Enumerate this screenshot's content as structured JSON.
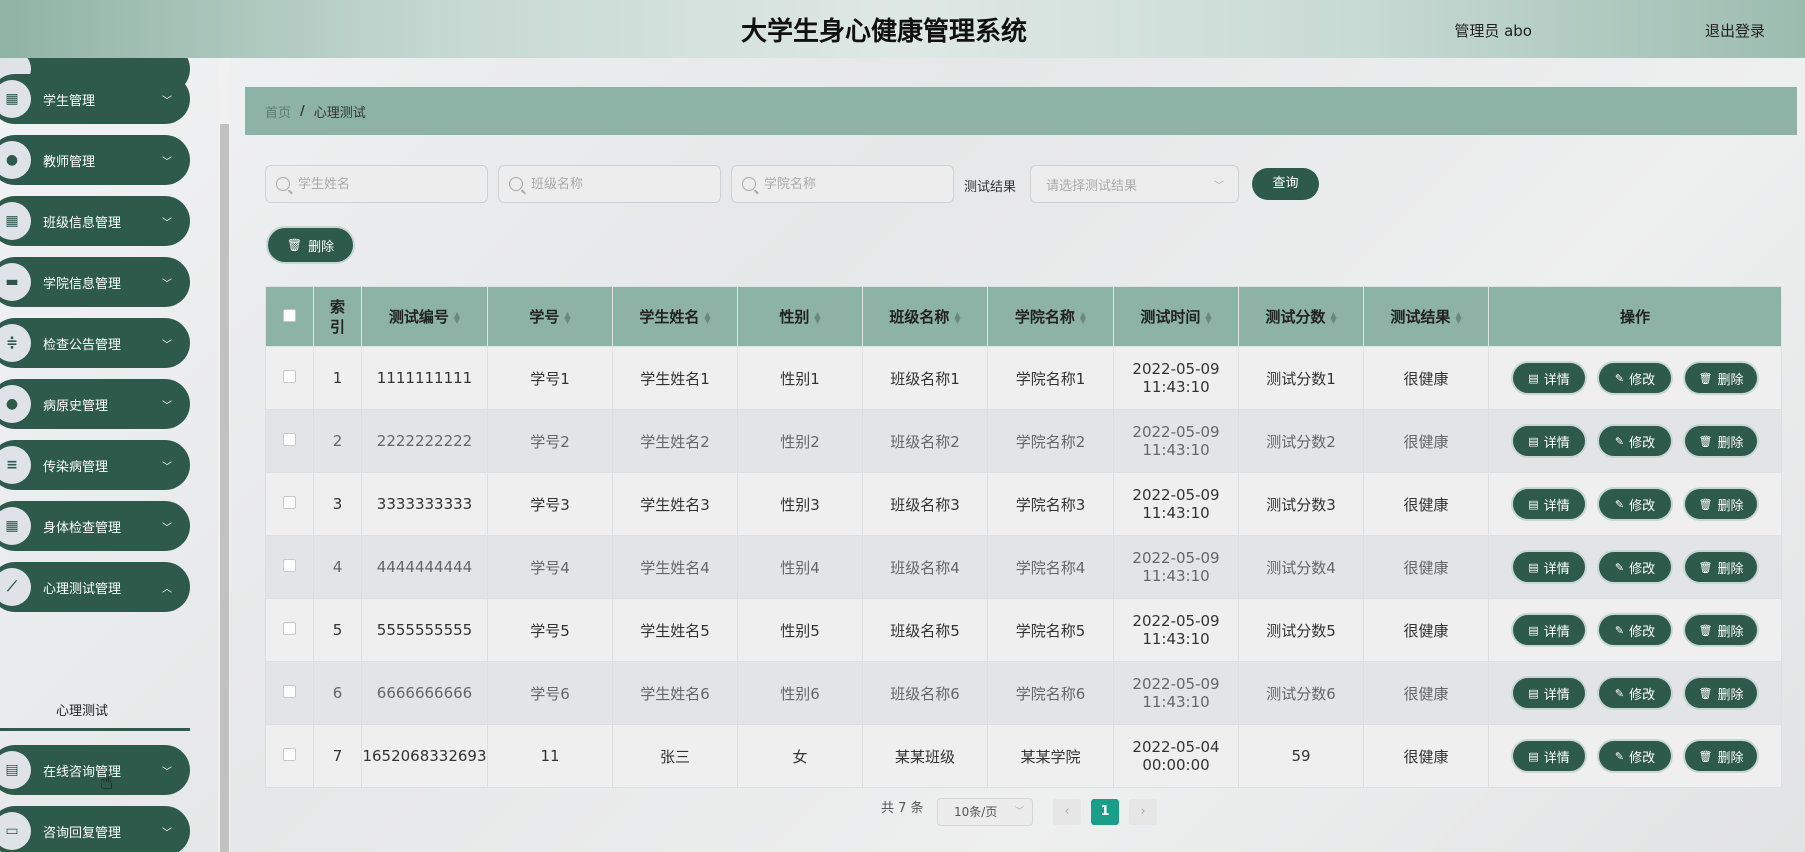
{
  "header": {
    "title": "大学生身心健康管理系统",
    "admin": "管理员 abo",
    "logout": "退出登录"
  },
  "sidebar": {
    "items": [
      {
        "label": "学生管理",
        "icon": "grid-icon"
      },
      {
        "label": "教师管理",
        "icon": "lightbulb-icon"
      },
      {
        "label": "班级信息管理",
        "icon": "grid-icon"
      },
      {
        "label": "学院信息管理",
        "icon": "briefcase-icon"
      },
      {
        "label": "检查公告管理",
        "icon": "sliders-icon"
      },
      {
        "label": "病原史管理",
        "icon": "user-icon"
      },
      {
        "label": "传染病管理",
        "icon": "list-icon"
      },
      {
        "label": "身体检查管理",
        "icon": "grid-icon"
      },
      {
        "label": "心理测试管理",
        "icon": "chart-icon"
      },
      {
        "label": "在线咨询管理",
        "icon": "clipboard-icon"
      },
      {
        "label": "咨询回复管理",
        "icon": "message-icon"
      }
    ],
    "submenu_active": "心理测试"
  },
  "breadcrumb": {
    "home": "首页",
    "separator": "/",
    "current": "心理测试"
  },
  "filters": {
    "student_name_placeholder": "学生姓名",
    "class_name_placeholder": "班级名称",
    "college_name_placeholder": "学院名称",
    "result_label": "测试结果",
    "result_placeholder": "请选择测试结果",
    "query_button": "查询"
  },
  "toolbar": {
    "delete_button": "删除"
  },
  "table": {
    "columns": [
      "索引",
      "测试编号",
      "学号",
      "学生姓名",
      "性别",
      "班级名称",
      "学院名称",
      "测试时间",
      "测试分数",
      "测试结果",
      "操作"
    ],
    "rows": [
      {
        "index": "1",
        "code": "1111111111",
        "student_no": "学号1",
        "name": "学生姓名1",
        "gender": "性别1",
        "class": "班级名称1",
        "college": "学院名称1",
        "time": "2022-05-09 11:43:10",
        "score": "测试分数1",
        "result": "很健康"
      },
      {
        "index": "2",
        "code": "2222222222",
        "student_no": "学号2",
        "name": "学生姓名2",
        "gender": "性别2",
        "class": "班级名称2",
        "college": "学院名称2",
        "time": "2022-05-09 11:43:10",
        "score": "测试分数2",
        "result": "很健康"
      },
      {
        "index": "3",
        "code": "3333333333",
        "student_no": "学号3",
        "name": "学生姓名3",
        "gender": "性别3",
        "class": "班级名称3",
        "college": "学院名称3",
        "time": "2022-05-09 11:43:10",
        "score": "测试分数3",
        "result": "很健康"
      },
      {
        "index": "4",
        "code": "4444444444",
        "student_no": "学号4",
        "name": "学生姓名4",
        "gender": "性别4",
        "class": "班级名称4",
        "college": "学院名称4",
        "time": "2022-05-09 11:43:10",
        "score": "测试分数4",
        "result": "很健康"
      },
      {
        "index": "5",
        "code": "5555555555",
        "student_no": "学号5",
        "name": "学生姓名5",
        "gender": "性别5",
        "class": "班级名称5",
        "college": "学院名称5",
        "time": "2022-05-09 11:43:10",
        "score": "测试分数5",
        "result": "很健康"
      },
      {
        "index": "6",
        "code": "6666666666",
        "student_no": "学号6",
        "name": "学生姓名6",
        "gender": "性别6",
        "class": "班级名称6",
        "college": "学院名称6",
        "time": "2022-05-09 11:43:10",
        "score": "测试分数6",
        "result": "很健康"
      },
      {
        "index": "7",
        "code": "1652068332693",
        "student_no": "11",
        "name": "张三",
        "gender": "女",
        "class": "某某班级",
        "college": "某某学院",
        "time": "2022-05-04 00:00:00",
        "score": "59",
        "result": "很健康"
      }
    ],
    "actions": {
      "detail": "详情",
      "edit": "修改",
      "delete": "删除"
    }
  },
  "pagination": {
    "total": "共 7 条",
    "page_size": "10条/页",
    "current_page": "1"
  },
  "colors": {
    "primary": "#2e5a4b",
    "header_accent": "#8cb3a5",
    "page_active": "#1a9e8a"
  }
}
